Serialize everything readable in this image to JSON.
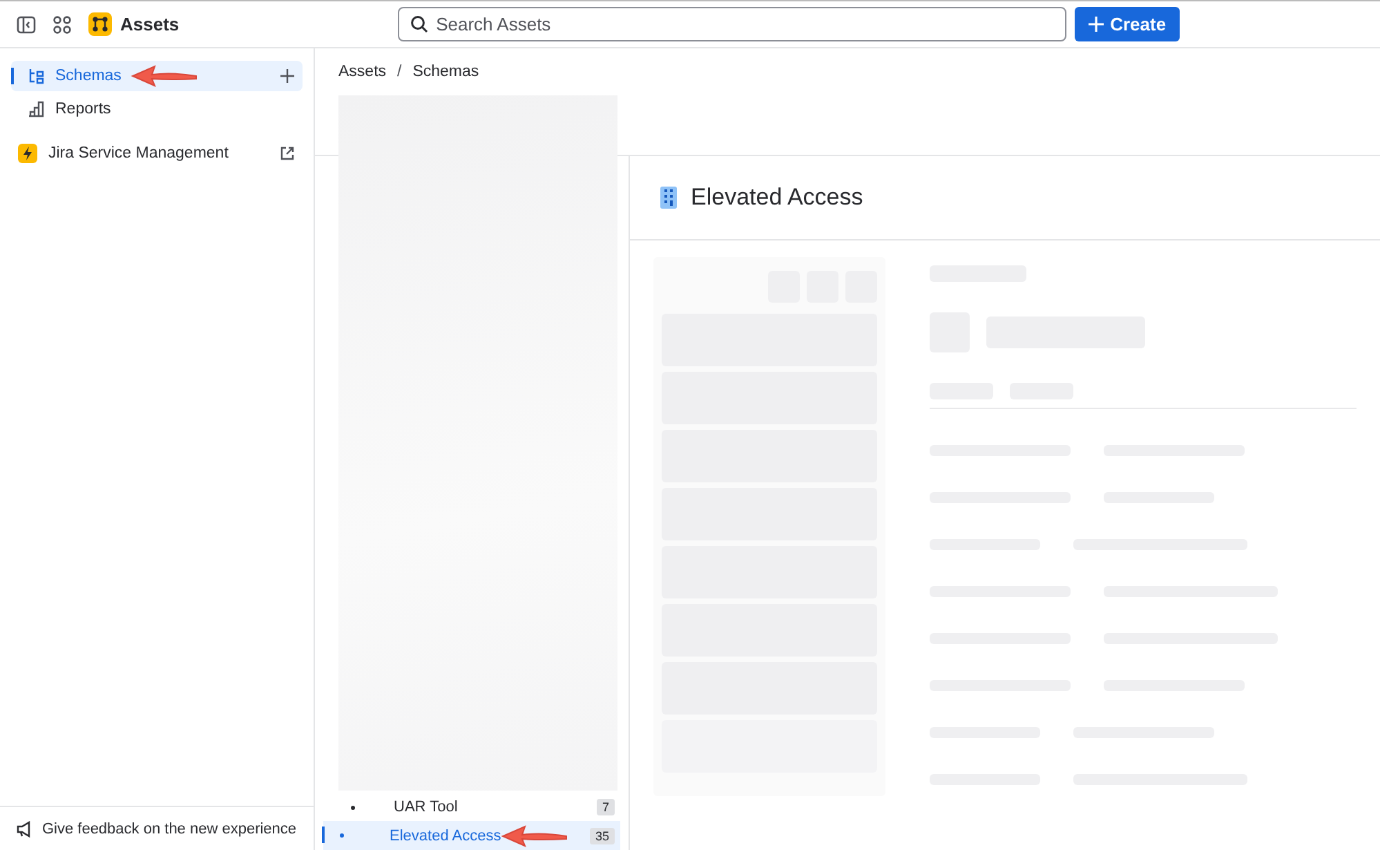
{
  "topbar": {
    "app_name": "Assets",
    "search": {
      "placeholder": "Search Assets"
    },
    "create_button": "Create"
  },
  "sidebar": {
    "items": [
      {
        "label": "Schemas",
        "selected": true,
        "kind": "add"
      },
      {
        "label": "Reports",
        "selected": false,
        "kind": "plain"
      },
      {
        "label": "Jira Service Management",
        "selected": false,
        "kind": "external"
      }
    ],
    "feedback": "Give feedback on the new experience"
  },
  "breadcrumbs": {
    "items": [
      "Assets",
      "Schemas"
    ],
    "separator": "/"
  },
  "tree": {
    "rows": [
      {
        "label": "UAR Tool",
        "count": "7",
        "selected": false
      },
      {
        "label": "Elevated Access",
        "count": "35",
        "selected": true
      }
    ]
  },
  "detail": {
    "title": "Elevated Access"
  }
}
